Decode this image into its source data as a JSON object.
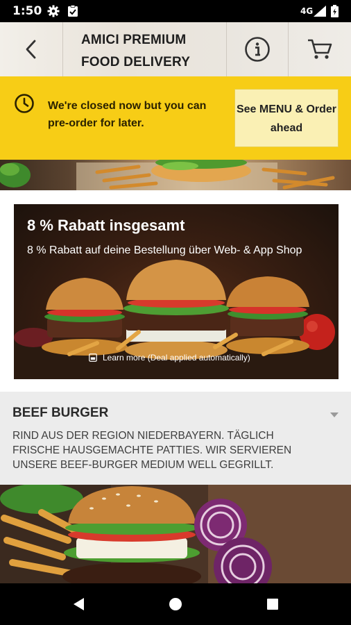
{
  "status_bar": {
    "time": "1:50",
    "network": "4G"
  },
  "header": {
    "title": "AMICI PREMIUM FOOD DELIVERY",
    "icons": [
      "back-arrow-icon",
      "info-icon",
      "cart-icon"
    ]
  },
  "closed_banner": {
    "message": "We're closed now but you can pre-order for later.",
    "button_label": "See MENU & Order ahead",
    "background": "#f7cd16"
  },
  "deal": {
    "title": "8 % Rabatt insgesamt",
    "description": "8 % Rabatt auf deine Bestellung über Web- & App Shop",
    "learn_more": "Learn more (Deal applied automatically)"
  },
  "category": {
    "title": "BEEF BURGER",
    "description": "RIND AUS DER REGION NIEDERBAYERN. TÄGLICH FRISCHE HAUSGEMACHTE PATTIES. WIR SERVIEREN UNSERE BEEF-BURGER MEDIUM WELL GEGRILLT."
  }
}
